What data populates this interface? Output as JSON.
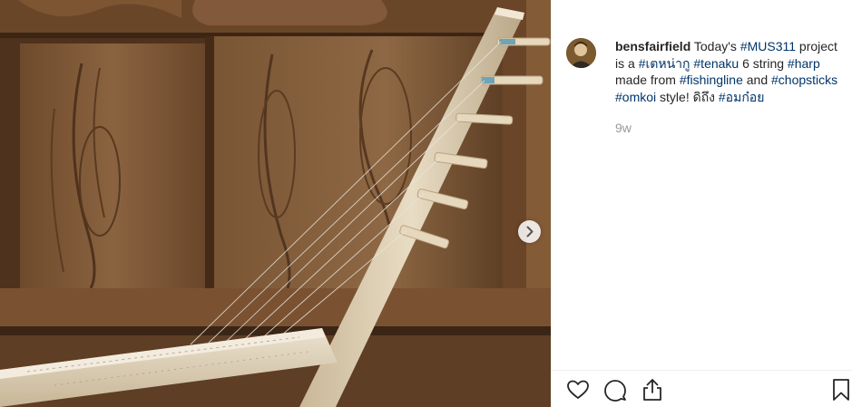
{
  "post": {
    "image_alt": "Wooden harp with fishing line strings and chopstick tuning pegs leaning against a wooden door panel",
    "next_arrow_icon": "chevron-right-icon"
  },
  "caption": {
    "username": "bensfairfield",
    "parts": [
      {
        "text": " Today's ",
        "tag": false
      },
      {
        "text": "#MUS311",
        "tag": true
      },
      {
        "text": " project is a ",
        "tag": false
      },
      {
        "text": "#เตหน่ากู",
        "tag": true
      },
      {
        "text": " ",
        "tag": false
      },
      {
        "text": "#tenaku",
        "tag": true
      },
      {
        "text": " 6 string ",
        "tag": false
      },
      {
        "text": "#harp",
        "tag": true
      },
      {
        "text": " made from ",
        "tag": false
      },
      {
        "text": "#fishingline",
        "tag": true
      },
      {
        "text": " and ",
        "tag": false
      },
      {
        "text": "#chopsticks",
        "tag": true
      },
      {
        "text": " ",
        "tag": false
      },
      {
        "text": "#omkoi",
        "tag": true
      },
      {
        "text": " style! ดิถึง ",
        "tag": false
      },
      {
        "text": "#อมก๋อย",
        "tag": true
      }
    ],
    "timestamp": "9w"
  },
  "actions": [
    {
      "name": "like-button",
      "icon": "heart-icon"
    },
    {
      "name": "comment-button",
      "icon": "comment-icon"
    },
    {
      "name": "share-button",
      "icon": "share-icon"
    },
    {
      "name": "save-button",
      "icon": "bookmark-icon"
    }
  ],
  "colors": {
    "hashtag": "#003569",
    "text": "#262626",
    "timestamp": "#999999",
    "wood_dark": "#5a3b22",
    "wood_light": "#d8c7a8"
  }
}
